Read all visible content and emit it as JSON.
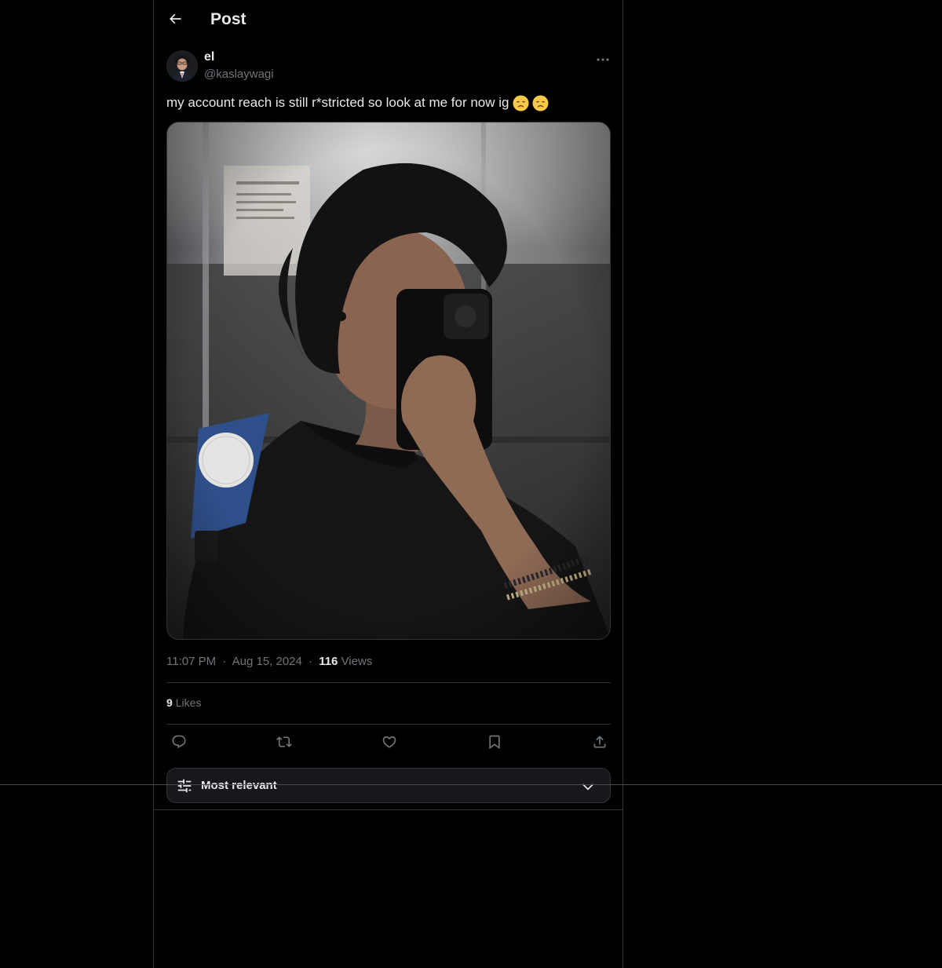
{
  "header": {
    "title": "Post"
  },
  "author": {
    "name": "el",
    "handle": "@kaslaywagi"
  },
  "post": {
    "text": "my account reach is still r*stricted so look at me for now ig",
    "emojis": [
      "disappointed-face",
      "disappointed-face"
    ]
  },
  "meta": {
    "time": "11:07 PM",
    "date": "Aug 15, 2024",
    "separator": "·",
    "views_count": "116",
    "views_label": "Views"
  },
  "stats": {
    "likes_count": "9",
    "likes_label": "Likes"
  },
  "actions": [
    "reply",
    "repost",
    "like",
    "bookmark",
    "share"
  ],
  "sort": {
    "label": "Most relevant"
  },
  "colors": {
    "background": "#000000",
    "border": "#2f3336",
    "text_primary": "#e7e9ea",
    "text_secondary": "#71767b",
    "sort_bar_bg": "#16181c"
  }
}
